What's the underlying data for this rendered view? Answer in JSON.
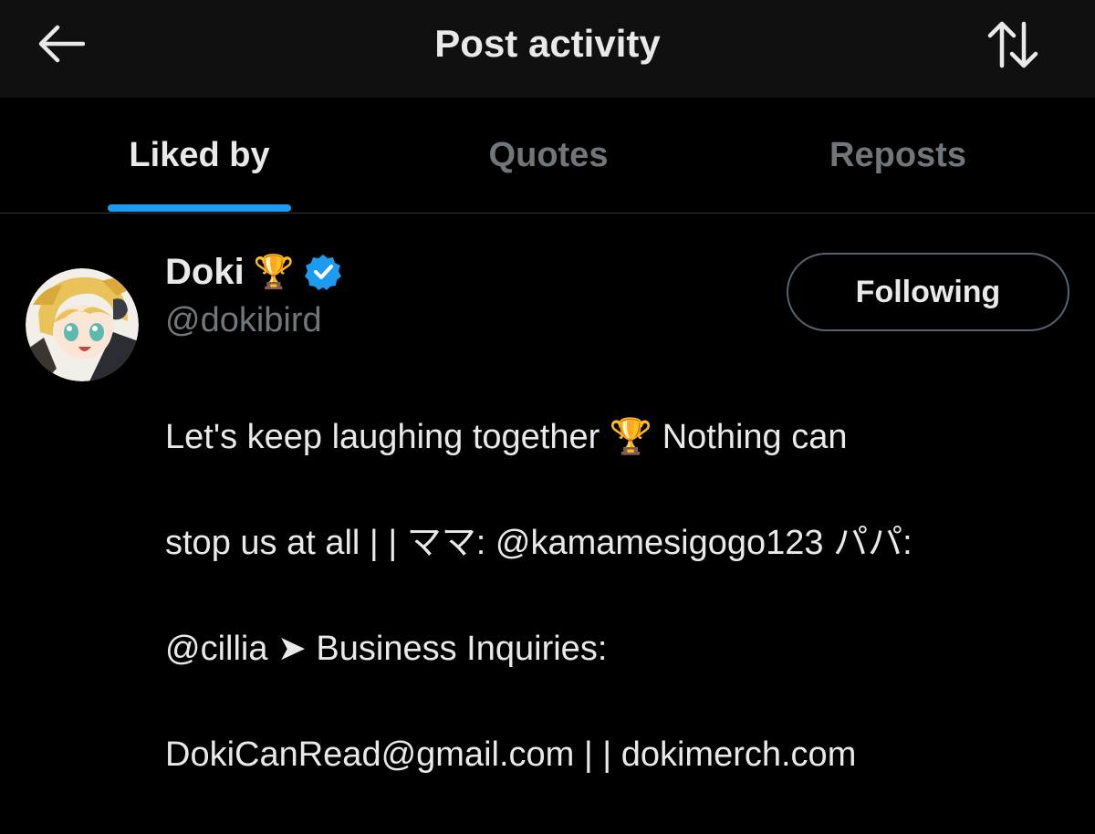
{
  "header": {
    "title": "Post activity",
    "back_icon": "arrow-left-icon",
    "sort_icon": "sort-arrows-icon"
  },
  "tabs": [
    {
      "label": "Liked by",
      "active": true
    },
    {
      "label": "Quotes",
      "active": false
    },
    {
      "label": "Reposts",
      "active": false
    }
  ],
  "colors": {
    "accent": "#1d9bf0",
    "background": "#000000",
    "header_background": "#101010",
    "muted_text": "#71767b",
    "text": "#e7e9ea"
  },
  "user": {
    "display_name": "Doki",
    "name_emoji": "🏆",
    "verified": true,
    "handle": "@dokibird",
    "follow_button_label": "Following",
    "bio_line1": "Let's keep laughing together 🏆 Nothing can",
    "bio_line2": "stop us at all | | ママ: @kamamesigogo123 パパ:",
    "bio_line3": "@cillia ➤ Business Inquiries:",
    "bio_line4": "DokiCanRead@gmail.com | | dokimerch.com"
  }
}
